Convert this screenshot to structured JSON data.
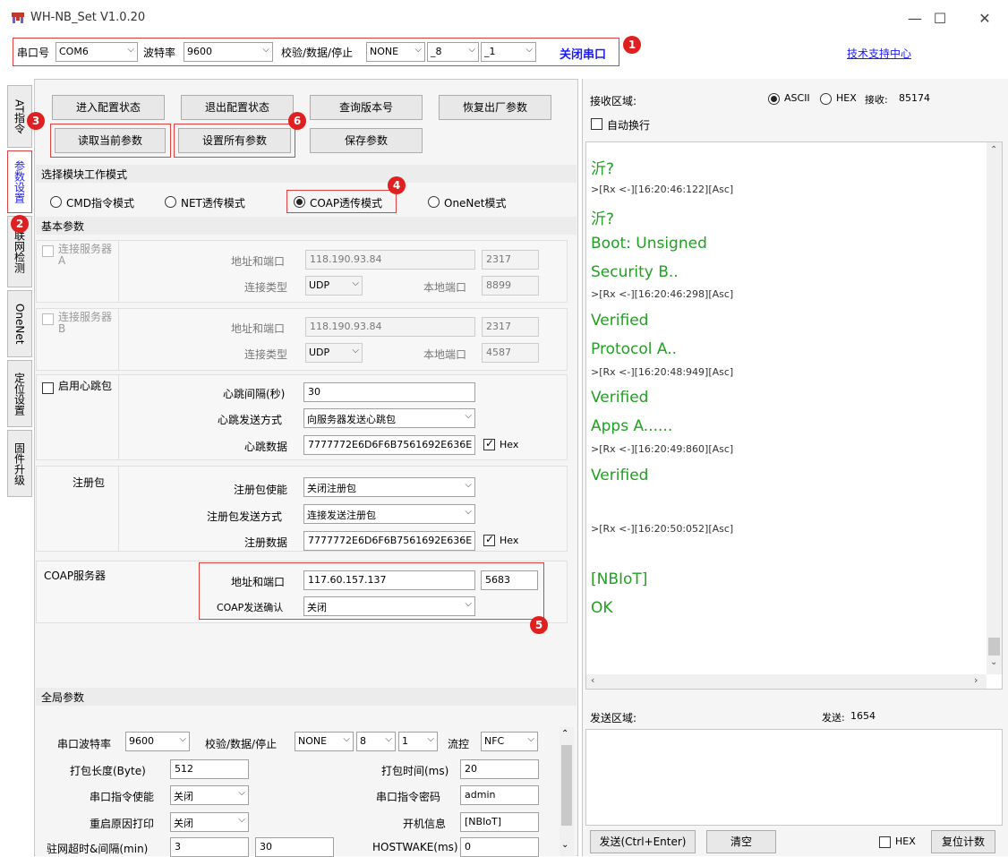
{
  "window": {
    "title": "WH-NB_Set V1.0.20"
  },
  "serial": {
    "port_label": "串口号",
    "port": "COM6",
    "baud_label": "波特率",
    "baud": "9600",
    "parity_label": "校验/数据/停止",
    "parity": "NONE",
    "databits": "8",
    "stopbits": "1",
    "close_label": "关闭串口",
    "support_link": "技术支持中心"
  },
  "badges": [
    "1",
    "2",
    "3",
    "4",
    "5",
    "6"
  ],
  "tabs": [
    "AT指令",
    "参数设置",
    "联网检测",
    "OneNet",
    "定位设置",
    "固件升级"
  ],
  "buttons": {
    "enter_config": "进入配置状态",
    "exit_config": "退出配置状态",
    "query_version": "查询版本号",
    "factory_reset": "恢复出厂参数",
    "read_params": "读取当前参数",
    "set_all": "设置所有参数",
    "save_params": "保存参数"
  },
  "mode": {
    "header": "选择模块工作模式",
    "options": [
      "CMD指令模式",
      "NET透传模式",
      "COAP透传模式",
      "OneNet模式"
    ],
    "selected": "COAP透传模式"
  },
  "basic": {
    "header": "基本参数",
    "serverA": {
      "label": "连接服务器A",
      "addr_label": "地址和端口",
      "addr": "118.190.93.84",
      "port": "2317",
      "type_label": "连接类型",
      "type": "UDP",
      "local_label": "本地端口",
      "local": "8899"
    },
    "serverB": {
      "label": "连接服务器B",
      "addr_label": "地址和端口",
      "addr": "118.190.93.84",
      "port": "2317",
      "type_label": "连接类型",
      "type": "UDP",
      "local_label": "本地端口",
      "local": "4587"
    },
    "heartbeat": {
      "label": "启用心跳包",
      "interval_label": "心跳间隔(秒)",
      "interval": "30",
      "send_label": "心跳发送方式",
      "send": "向服务器发送心跳包",
      "data_label": "心跳数据",
      "data": "7777772E6D6F6B7561692E636E",
      "hex": "Hex"
    },
    "register": {
      "label": "注册包",
      "enable_label": "注册包使能",
      "enable": "关闭注册包",
      "send_label": "注册包发送方式",
      "send": "连接发送注册包",
      "data_label": "注册数据",
      "data": "7777772E6D6F6B7561692E636E",
      "hex": "Hex"
    },
    "coap": {
      "label": "COAP服务器",
      "addr_label": "地址和端口",
      "addr": "117.60.157.137",
      "port": "5683",
      "confirm_label": "COAP发送确认",
      "confirm": "关闭"
    }
  },
  "global": {
    "header": "全局参数",
    "baud_label": "串口波特率",
    "baud": "9600",
    "parity_label": "校验/数据/停止",
    "parity": "NONE",
    "databits": "8",
    "stopbits": "1",
    "flow_label": "流控",
    "flow": "NFC",
    "pack_len_label": "打包长度(Byte)",
    "pack_len": "512",
    "pack_time_label": "打包时间(ms)",
    "pack_time": "20",
    "cmd_enable_label": "串口指令使能",
    "cmd_enable": "关闭",
    "cmd_pwd_label": "串口指令密码",
    "cmd_pwd": "admin",
    "reboot_label": "重启原因打印",
    "reboot": "关闭",
    "boot_info_label": "开机信息",
    "boot_info": "[NBIoT]",
    "net_timeout_label": "驻网超时&间隔(min)",
    "net_timeout": "3",
    "net_interval": "30",
    "hostwake_label": "HOSTWAKE(ms)",
    "hostwake": "0"
  },
  "receive": {
    "label": "接收区域:",
    "ascii": "ASCII",
    "hex": "HEX",
    "count_label": "接收:",
    "count": "85174",
    "autowrap": "自动换行",
    "lines": [
      {
        "text": "沂?",
        "kind": "big"
      },
      {
        "text": ">[Rx <-][16:20:46:122][Asc]",
        "kind": "small"
      },
      {
        "text": "沂?",
        "kind": "big"
      },
      {
        "text": "Boot: Unsigned",
        "kind": "big"
      },
      {
        "text": "Security B..",
        "kind": "big"
      },
      {
        "text": ">[Rx <-][16:20:46:298][Asc]",
        "kind": "small"
      },
      {
        "text": "Verified",
        "kind": "big"
      },
      {
        "text": "Protocol A..",
        "kind": "big"
      },
      {
        "text": ">[Rx <-][16:20:48:949][Asc]",
        "kind": "small"
      },
      {
        "text": "Verified",
        "kind": "big"
      },
      {
        "text": "Apps A......",
        "kind": "big"
      },
      {
        "text": ">[Rx <-][16:20:49:860][Asc]",
        "kind": "small"
      },
      {
        "text": "Verified",
        "kind": "big"
      },
      {
        "text": ">[Rx <-][16:20:50:052][Asc]",
        "kind": "small"
      },
      {
        "text": "[NBIoT]",
        "kind": "big"
      },
      {
        "text": "OK",
        "kind": "big"
      }
    ]
  },
  "send": {
    "label": "发送区域:",
    "count_label": "发送:",
    "count": "1654",
    "send_btn": "发送(Ctrl+Enter)",
    "clear_btn": "清空",
    "hex": "HEX",
    "reset_btn": "复位计数"
  }
}
